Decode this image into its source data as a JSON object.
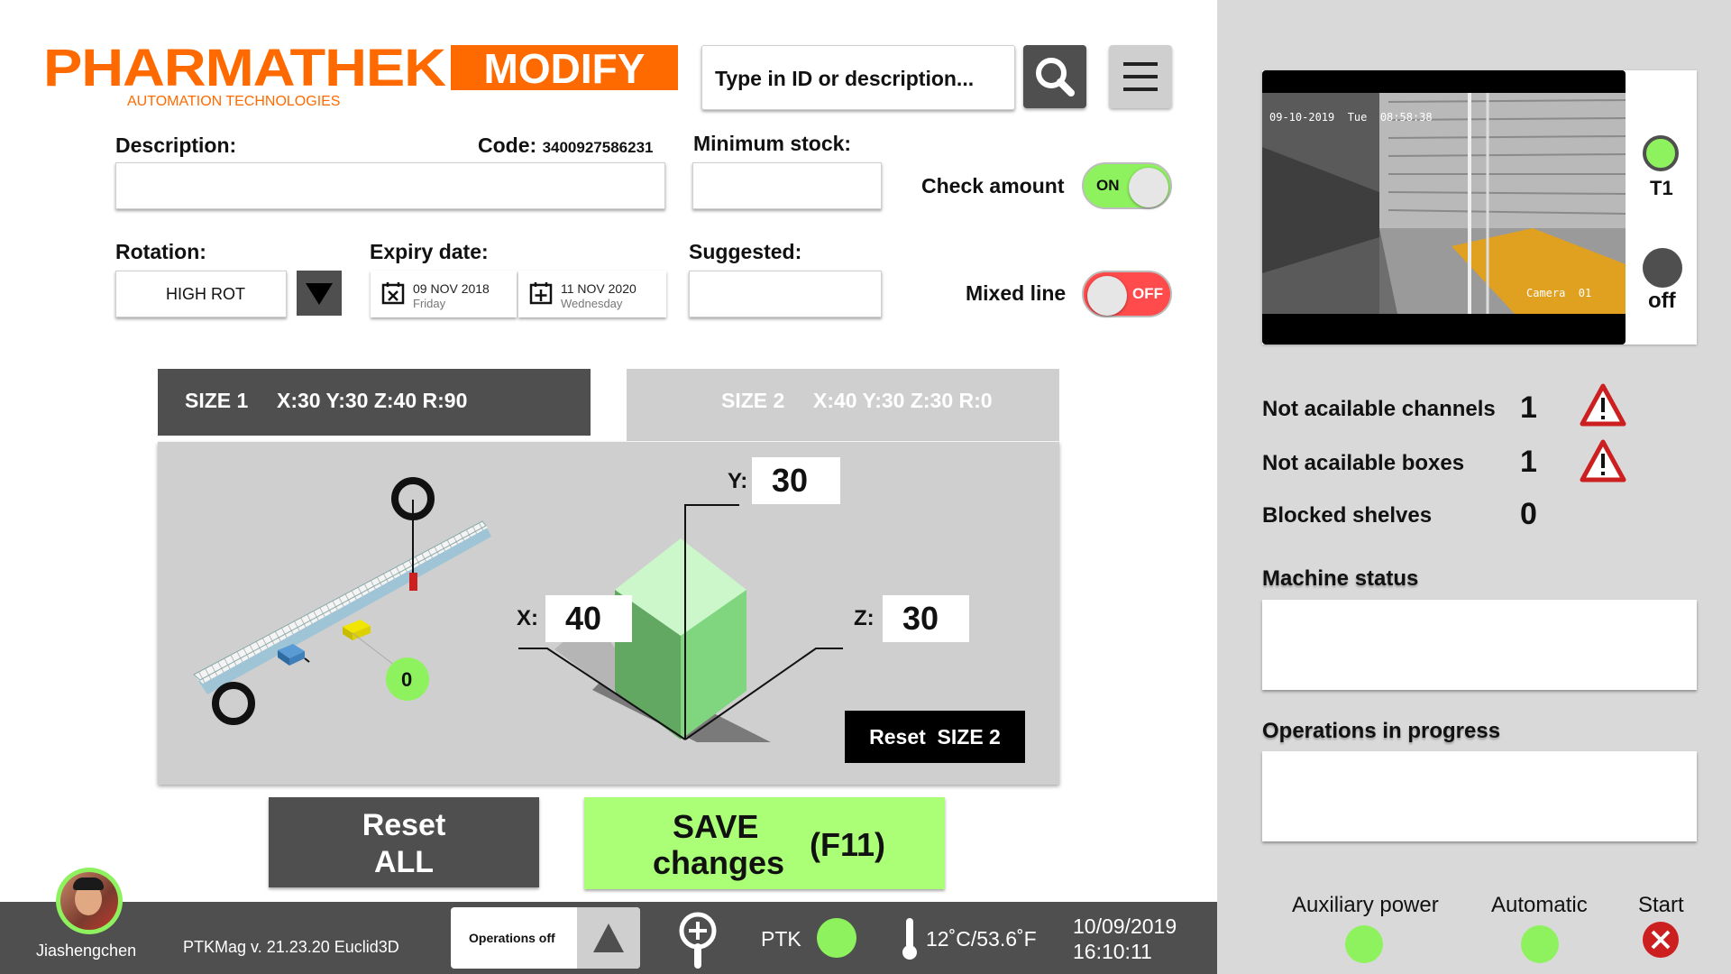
{
  "brand": {
    "name": "PHARMATHEK",
    "tagline": "AUTOMATION TECHNOLOGIES",
    "mode": "MODIFY",
    "orange": "#ff6a00"
  },
  "search": {
    "placeholder": "Type in ID or description..."
  },
  "form": {
    "description_label": "Description:",
    "code_label": "Code:",
    "code_value": "3400927586231",
    "min_stock_label": "Minimum stock:",
    "check_amount_label": "Check amount",
    "check_amount_state": "ON",
    "rotation_label": "Rotation:",
    "rotation_value": "HIGH ROT",
    "expiry_label": "Expiry date:",
    "expiry_from": {
      "date": "09 NOV 2018",
      "day": "Friday"
    },
    "expiry_to": {
      "date": "11 NOV 2020",
      "day": "Wednesday"
    },
    "suggested_label": "Suggested:",
    "mixed_line_label": "Mixed line",
    "mixed_line_state": "OFF"
  },
  "sizes": {
    "tab1": {
      "name": "SIZE 1",
      "dims": "X:30 Y:30 Z:40 R:90"
    },
    "tab2": {
      "name": "SIZE 2",
      "dims": "X:40 Y:30 Z:30 R:0"
    },
    "conveyor_counter": "0",
    "x_label": "X:",
    "x_value": "40",
    "y_label": "Y:",
    "y_value": "30",
    "z_label": "Z:",
    "z_value": "30",
    "reset_size2": "Reset  SIZE 2"
  },
  "actions": {
    "reset_all_line1": "Reset",
    "reset_all_line2": "ALL",
    "save_line1": "SAVE",
    "save_line2": "changes",
    "save_key": "(F11)"
  },
  "camera": {
    "timestamp": "09-10-2019  Tue  08:58:38",
    "label": "Camera  01",
    "indicator1": "T1",
    "indicator2": "off"
  },
  "status": {
    "rows": [
      {
        "label": "Not acailable channels",
        "value": "1"
      },
      {
        "label": "Not acailable boxes",
        "value": "1"
      },
      {
        "label": "Blocked shelves",
        "value": "0"
      }
    ],
    "machine_status_label": "Machine status",
    "operations_label": "Operations in progress"
  },
  "indicators": {
    "aux": "Auxiliary power",
    "automatic": "Automatic",
    "start": "Start"
  },
  "footer": {
    "user": "Jiashengchen",
    "version": "PTKMag v. 21.23.20 Euclid3D",
    "operations": "Operations off",
    "ptk": "PTK",
    "temperature": "12˚C/53.6˚F",
    "date": "10/09/2019",
    "time": "16:10:11"
  },
  "colors": {
    "green": "#8ef25f",
    "red": "#ff4b4b",
    "dark": "#4f4f4f",
    "save_bg": "#aaff77"
  }
}
